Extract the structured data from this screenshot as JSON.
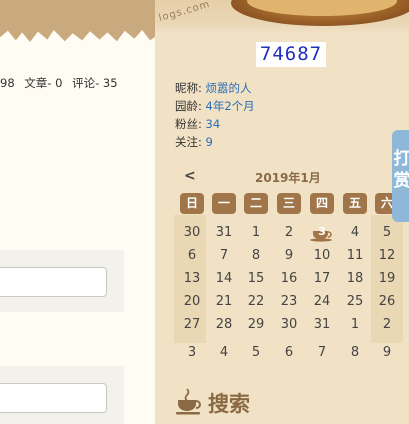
{
  "blog_stats": {
    "posts_fragment": "98",
    "articles": "文章- 0",
    "comments": "评论- 35"
  },
  "banner": {
    "blog_link_fragment": "logs.com"
  },
  "visit_counter": "74687",
  "profile": {
    "nickname_label": "昵称:",
    "nickname_value": "烦嚣的人",
    "age_label": "园龄:",
    "age_value": "4年2个月",
    "fans_label": "粉丝:",
    "fans_value": "34",
    "follow_label": "关注:",
    "follow_value": "9"
  },
  "calendar": {
    "prev_label": "<",
    "title": "2019年1月",
    "weekdays": [
      "日",
      "一",
      "二",
      "三",
      "四",
      "五",
      "六"
    ],
    "weeks": [
      [
        "30",
        "31",
        "1",
        "2",
        "3",
        "4",
        "5"
      ],
      [
        "6",
        "7",
        "8",
        "9",
        "10",
        "11",
        "12"
      ],
      [
        "13",
        "14",
        "15",
        "16",
        "17",
        "18",
        "19"
      ],
      [
        "20",
        "21",
        "22",
        "23",
        "24",
        "25",
        "26"
      ],
      [
        "27",
        "28",
        "29",
        "30",
        "31",
        "1",
        "2"
      ],
      [
        "3",
        "4",
        "5",
        "6",
        "7",
        "8",
        "9"
      ]
    ],
    "today": "3",
    "icon": "coffee-cup-icon"
  },
  "search": {
    "title": "搜索",
    "icon": "coffee-cup-icon"
  },
  "floating_tab": {
    "chars": [
      "打",
      "赏"
    ]
  },
  "colors": {
    "accent_brown": "#a0754a",
    "link_blue": "#2a6fb5",
    "counter_blue": "#1f2fbf",
    "sidebar_bg": "#f1e2c6",
    "tab_blue": "#8fb8d8"
  }
}
